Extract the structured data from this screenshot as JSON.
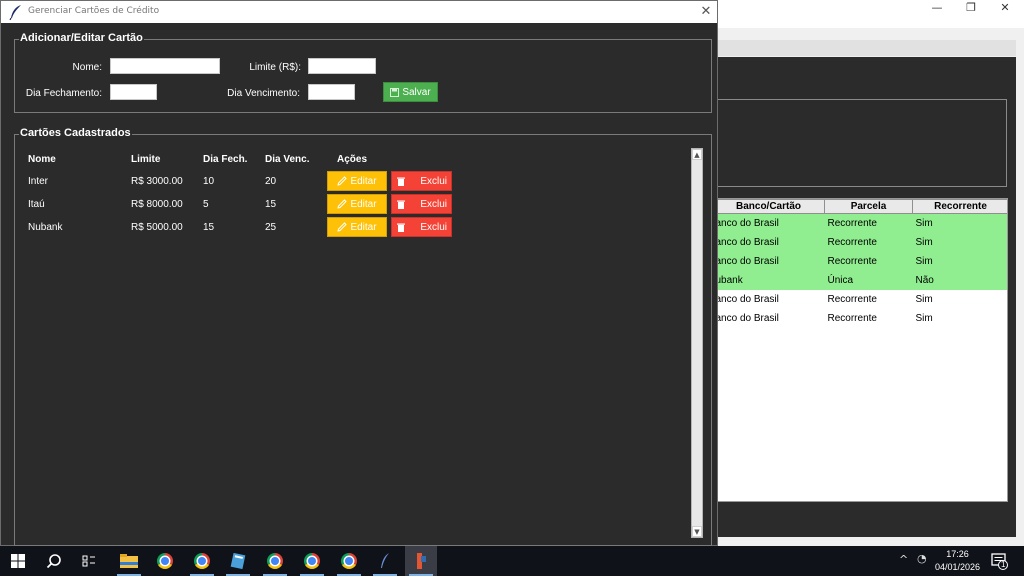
{
  "dialog": {
    "title": "Gerenciar Cartões de Crédito",
    "close_glyph": "✕"
  },
  "form": {
    "group_title": "Adicionar/Editar Cartão",
    "nome_label": "Nome:",
    "nome_value": "",
    "limite_label": "Limite (R$):",
    "limite_value": "",
    "fechamento_label": "Dia Fechamento:",
    "fechamento_value": "",
    "vencimento_label": "Dia Vencimento:",
    "vencimento_value": "",
    "save_label": "Salvar",
    "save_icon": "save-icon"
  },
  "cards": {
    "group_title": "Cartões Cadastrados",
    "headers": [
      "Nome",
      "Limite",
      "Dia Fech.",
      "Dia Venc.",
      "Ações"
    ],
    "rows": [
      {
        "nome": "Inter",
        "limite": "R$ 3000.00",
        "fech": "10",
        "venc": "20"
      },
      {
        "nome": "Itaú",
        "limite": "R$ 8000.00",
        "fech": "5",
        "venc": "15"
      },
      {
        "nome": "Nubank",
        "limite": "R$ 5000.00",
        "fech": "15",
        "venc": "25"
      }
    ],
    "edit_label": "Editar",
    "delete_label": "Exclui",
    "edit_icon": "pencil-icon",
    "delete_icon": "trash-icon"
  },
  "background": {
    "window_controls": [
      "—",
      "❐",
      "✕"
    ],
    "table_headers": [
      "Banco/Cartão",
      "Parcela",
      "Recorrente"
    ],
    "table_rows": [
      {
        "banco": "anco do Brasil",
        "parcela": "Recorrente",
        "recorrente": "Sim",
        "highlight": true
      },
      {
        "banco": "anco do Brasil",
        "parcela": "Recorrente",
        "recorrente": "Sim",
        "highlight": true
      },
      {
        "banco": "anco do Brasil",
        "parcela": "Recorrente",
        "recorrente": "Sim",
        "highlight": true
      },
      {
        "banco": "ubank",
        "parcela": "Única",
        "recorrente": "Não",
        "highlight": true
      },
      {
        "banco": "anco do Brasil",
        "parcela": "Recorrente",
        "recorrente": "Sim",
        "highlight": false
      },
      {
        "banco": "anco do Brasil",
        "parcela": "Recorrente",
        "recorrente": "Sim",
        "highlight": false
      }
    ],
    "highlight_color": "#90ee90"
  },
  "taskbar": {
    "time": "17:26",
    "date": "04/01/2026",
    "notification_count": "1",
    "apps": [
      "windows-start-icon",
      "search-icon",
      "task-view-icon",
      "file-explorer-icon",
      "chrome-icon",
      "chrome-profile-icon",
      "notes-icon",
      "chrome-icon",
      "chrome-profile-icon",
      "chrome-profile-icon",
      "feather-icon",
      "python-app-icon"
    ]
  },
  "colors": {
    "dialog_bg": "#2b2b2b",
    "save_button": "#4caf50",
    "edit_button": "#ffc107",
    "delete_button": "#f44336"
  }
}
